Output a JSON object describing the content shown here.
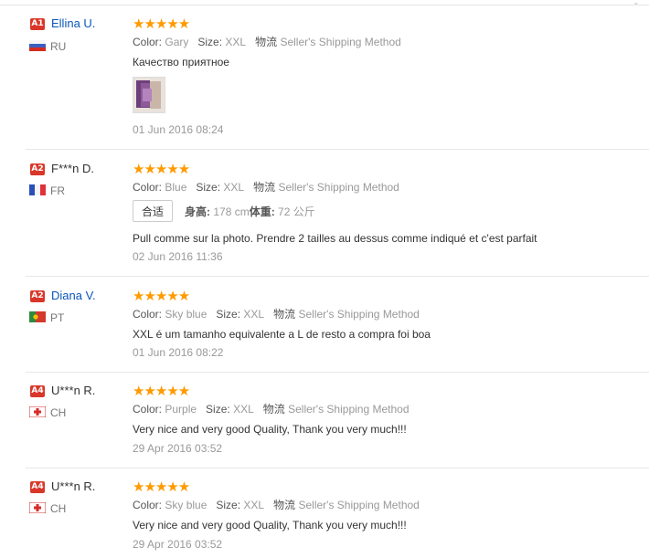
{
  "reviews": [
    {
      "badge": "A1",
      "name": "Ellina U.",
      "name_style": "link",
      "country": "RU",
      "stars": "★★★★★",
      "color_label": "Color:",
      "color_value": "Gary",
      "size_label": "Size:",
      "size_value": "XXL",
      "logistics_label": "物流",
      "logistics_value": "Seller's Shipping Method",
      "text": "Качество приятное",
      "date": "01 Jun 2016 08:24"
    },
    {
      "badge": "A2",
      "name": "F***n D.",
      "name_style": "plain",
      "country": "FR",
      "stars": "★★★★★",
      "color_label": "Color:",
      "color_value": "Blue",
      "size_label": "Size:",
      "size_value": "XXL",
      "logistics_label": "物流",
      "logistics_value": "Seller's Shipping Method",
      "fit_label": "合适",
      "height_label": "身高:",
      "height_value": "178 cm",
      "weight_label": "体重:",
      "weight_value": "72 公斤",
      "text": "Pull comme sur la photo. Prendre 2 tailles au dessus comme indiqué et c'est parfait",
      "date": "02 Jun 2016 11:36"
    },
    {
      "badge": "A2",
      "name": "Diana V.",
      "name_style": "link",
      "country": "PT",
      "stars": "★★★★★",
      "color_label": "Color:",
      "color_value": "Sky blue",
      "size_label": "Size:",
      "size_value": "XXL",
      "logistics_label": "物流",
      "logistics_value": "Seller's Shipping Method",
      "text": "XXL é um tamanho equivalente a L de resto a compra foi boa",
      "date": "01 Jun 2016 08:22"
    },
    {
      "badge": "A4",
      "name": "U***n R.",
      "name_style": "plain",
      "country": "CH",
      "stars": "★★★★★",
      "color_label": "Color:",
      "color_value": "Purple",
      "size_label": "Size:",
      "size_value": "XXL",
      "logistics_label": "物流",
      "logistics_value": "Seller's Shipping Method",
      "text": "Very nice and very good Quality, Thank you very much!!!",
      "date": "29 Apr 2016 03:52"
    },
    {
      "badge": "A4",
      "name": "U***n R.",
      "name_style": "plain",
      "country": "CH",
      "stars": "★★★★★",
      "color_label": "Color:",
      "color_value": "Sky blue",
      "size_label": "Size:",
      "size_value": "XXL",
      "logistics_label": "物流",
      "logistics_value": "Seller's Shipping Method",
      "text": "Very nice and very good Quality, Thank you very much!!!",
      "date": "29 Apr 2016 03:52"
    }
  ],
  "colors": {
    "badge": "#d9372a",
    "star": "#ff9a00",
    "link": "#0a56b9",
    "muted": "#999999"
  }
}
